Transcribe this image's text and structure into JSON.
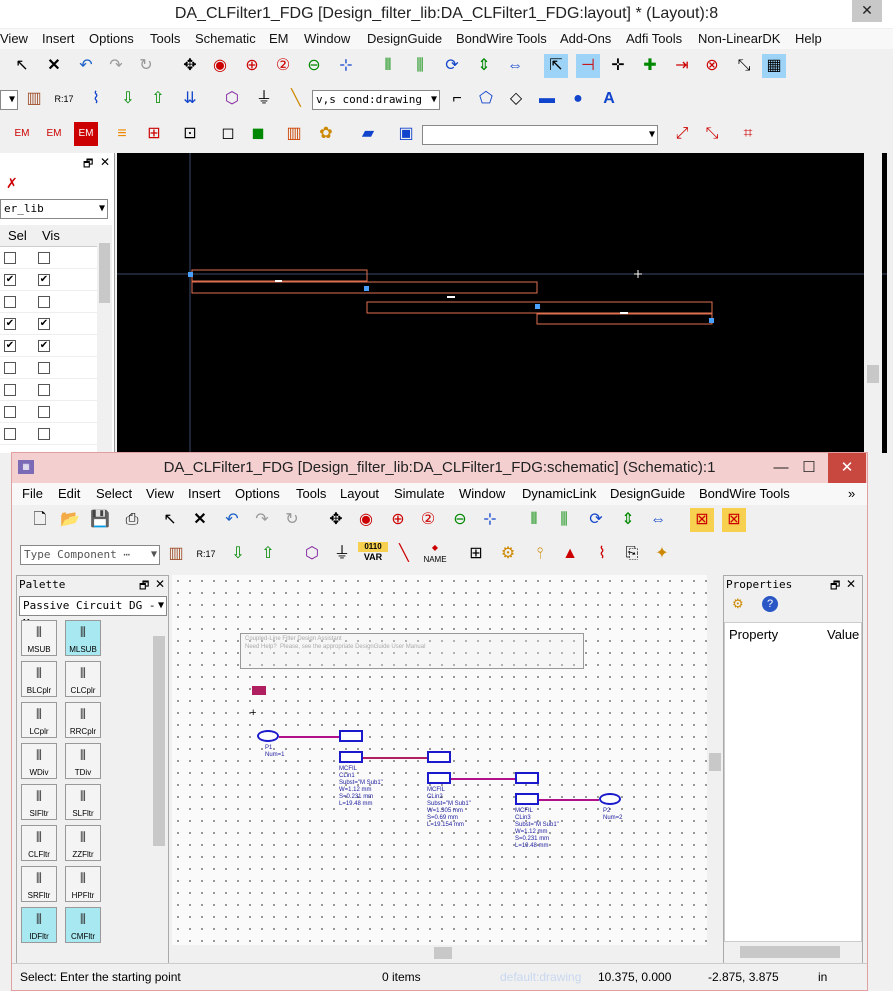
{
  "layout_window": {
    "title": "DA_CLFilter1_FDG [Design_filter_lib:DA_CLFilter1_FDG:layout] * (Layout):8",
    "menu": [
      "View",
      "Insert",
      "Options",
      "Tools",
      "Schematic",
      "EM",
      "Window",
      "DesignGuide",
      "BondWire Tools",
      "Add-Ons",
      "Adfi Tools",
      "Non-LinearDK",
      "Help"
    ],
    "layer_combo": "v,s cond:drawing",
    "lib_combo": "er_lib",
    "col_sel": "Sel",
    "col_vis": "Vis",
    "rows": [
      [
        false,
        false
      ],
      [
        true,
        true
      ],
      [
        false,
        false
      ],
      [
        true,
        true
      ],
      [
        true,
        true
      ],
      [
        false,
        false
      ],
      [
        false,
        false
      ],
      [
        false,
        false
      ],
      [
        false,
        false
      ]
    ]
  },
  "schematic_window": {
    "title": "DA_CLFilter1_FDG [Design_filter_lib:DA_CLFilter1_FDG:schematic] (Schematic):1",
    "menu": [
      "File",
      "Edit",
      "Select",
      "View",
      "Insert",
      "Options",
      "Tools",
      "Layout",
      "Simulate",
      "Window",
      "DynamicLink",
      "DesignGuide",
      "BondWire Tools"
    ],
    "menu_more": "»",
    "component_placeholder": "Type Component ⋯",
    "var_label": "VAR",
    "name_label": "NAME",
    "var_bits": "0110",
    "palette_title": "Palette",
    "palette_combo": "Passive Circuit DG - M",
    "palette_items": [
      [
        "MSUB",
        "MLSUB"
      ],
      [
        "BLCplr",
        "CLCplr"
      ],
      [
        "LCplr",
        "RRCplr"
      ],
      [
        "WDiv",
        "TDiv"
      ],
      [
        "SIFltr",
        "SLFltr"
      ],
      [
        "CLFltr",
        "ZZFltr"
      ],
      [
        "SRFltr",
        "HPFltr"
      ],
      [
        "IDFltr",
        "CMFltr"
      ]
    ],
    "properties_title": "Properties",
    "prop_col1": "Property",
    "prop_col2": "Value",
    "note_line1": "Coupled-Line Filter Design Assistant",
    "note_line2": "Need Help?  Please, see the appropriate DesignGuide User Manual",
    "p1": "P1\nNum=1",
    "p2": "P2\nNum=2",
    "clin1": "MCFIL\nCLin1\nSubst=\"M Sub1\"\nW=1.12 mm\nS=0.231 mm\nL=19.48 mm",
    "clin2": "MCFIL\nCLin2\nSubst=\"M Sub1\"\nW=1.305 mm\nS=0.69 mm\nL=19.154 mm",
    "clin3": "MCFIL\nCLin3\nSubst=\"M Sub1\"\nW=1.12 mm\nS=0.231 mm\nL=19.48 mm",
    "status": {
      "prompt": "Select: Enter the starting point",
      "items": "0 items",
      "layer": "default:drawing",
      "coord1": "10.375, 0.000",
      "coord2": "-2.875, 3.875",
      "unit": "in"
    }
  }
}
